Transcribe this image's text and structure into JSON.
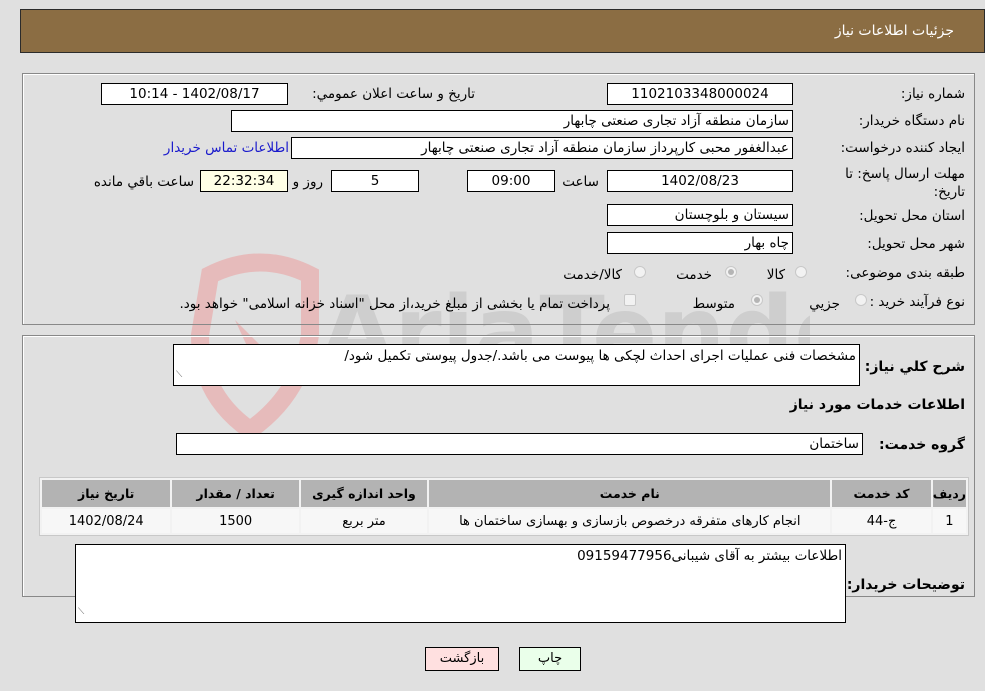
{
  "header": {
    "title": "جزئیات اطلاعات نیاز"
  },
  "form": {
    "need_number": {
      "label": "شماره نیاز:",
      "value": "1102103348000024"
    },
    "announce_datetime": {
      "label": "تاریخ و ساعت اعلان عمومي:",
      "value": "1402/08/17 - 10:14"
    },
    "buyer_org": {
      "label": "نام دستگاه خریدار:",
      "value": "سازمان منطقه آزاد تجاری صنعتی چابهار"
    },
    "requester": {
      "label": "ایجاد کننده درخواست:",
      "value": "عبدالغفور محبی کارپرداز سازمان منطقه آزاد تجاری صنعتی چابهار"
    },
    "buyer_contact_link": "اطلاعات تماس خریدار",
    "deadline": {
      "label": "مهلت ارسال پاسخ: تا تاریخ:",
      "date": "1402/08/23",
      "time_label": "ساعت",
      "time": "09:00",
      "days": "5",
      "days_label": "روز و",
      "remaining": "22:32:34",
      "remaining_label": "ساعت باقي مانده"
    },
    "province": {
      "label": "استان محل تحویل:",
      "value": "سیستان و بلوچستان"
    },
    "city": {
      "label": "شهر محل تحویل:",
      "value": "چاه بهار"
    },
    "category": {
      "label": "طبقه بندی موضوعی:",
      "options": [
        "کالا",
        "خدمت",
        "کالا/خدمت"
      ],
      "selected": "خدمت"
    },
    "process_type": {
      "label": "نوع فرآیند خرید :",
      "options": [
        "جزيي",
        "متوسط"
      ],
      "selected": "متوسط",
      "treasury_note": "پرداخت تمام یا بخشی از مبلغ خرید،از محل \"اسناد خزانه اسلامی\" خواهد بود.",
      "treasury_checked": false
    }
  },
  "details": {
    "description": {
      "label": "شرح كلي نياز:",
      "value": "مشخصات فنی عملیات اجرای احداث لچکی ها پیوست می باشد./جدول پیوستی تکمیل شود/"
    },
    "services_title": "اطلاعات خدمات مورد نياز",
    "service_group": {
      "label": "گروه خدمت:",
      "value": "ساختمان"
    },
    "table": {
      "headers": [
        "رديف",
        "کد خدمت",
        "نام خدمت",
        "واحد اندازه گیری",
        "تعداد / مقدار",
        "تاریخ نیاز"
      ],
      "rows": [
        [
          "1",
          "ج-44",
          "انجام کارهای متفرقه درخصوص بازسازی و بهسازی ساختمان ها",
          "متر بربع",
          "1500",
          "1402/08/24"
        ]
      ]
    },
    "buyer_notes": {
      "label": "توضیحات خریدار:",
      "value": "اطلاعات بیشتر به آقای شیبانی09159477956"
    }
  },
  "buttons": {
    "print": "چاپ",
    "back": "بازگشت"
  },
  "watermark": {
    "text": "AriaTender.neT"
  },
  "colors": {
    "header_bg": "#8b6d43",
    "link": "#1a1acc",
    "print_bg": "#eaffea",
    "back_bg": "#ffe0e0"
  }
}
